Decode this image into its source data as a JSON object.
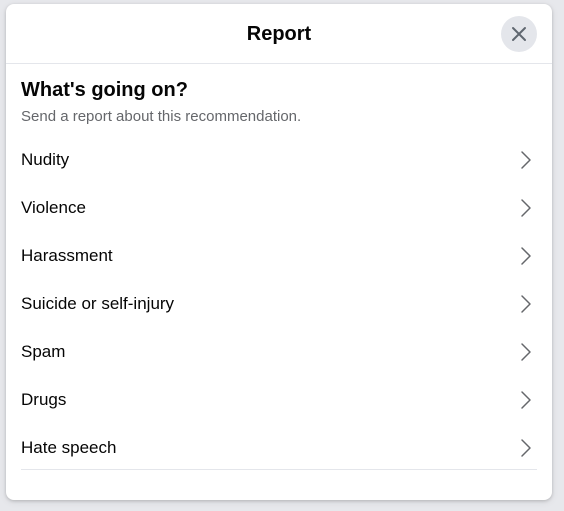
{
  "dialog": {
    "title": "Report",
    "close_icon": "close-icon"
  },
  "content": {
    "heading": "What's going on?",
    "subheading": "Send a report about this recommendation."
  },
  "options": [
    {
      "label": "Nudity",
      "icon": "chevron-right-icon"
    },
    {
      "label": "Violence",
      "icon": "chevron-right-icon"
    },
    {
      "label": "Harassment",
      "icon": "chevron-right-icon"
    },
    {
      "label": "Suicide or self-injury",
      "icon": "chevron-right-icon"
    },
    {
      "label": "Spam",
      "icon": "chevron-right-icon"
    },
    {
      "label": "Drugs",
      "icon": "chevron-right-icon"
    },
    {
      "label": "Hate speech",
      "icon": "chevron-right-icon"
    }
  ],
  "colors": {
    "text_primary": "#050505",
    "text_secondary": "#65676b",
    "divider": "#e4e6eb",
    "close_button_bg": "#e4e6eb",
    "chevron": "#65676b"
  }
}
